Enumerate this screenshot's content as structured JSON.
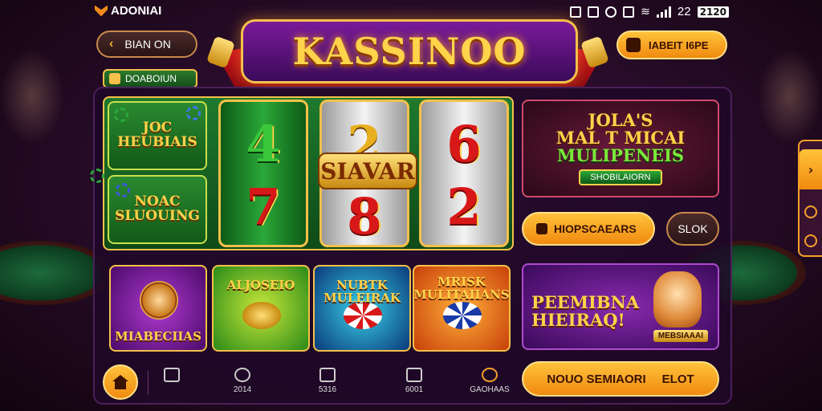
{
  "status": {
    "brand": "ADONIAI",
    "time": "22",
    "battery": "2120"
  },
  "header": {
    "left_button": "BIAN ON",
    "right_button": "IABEIT I6PE",
    "title": "KASSINOO",
    "chip": "DOABOIUN"
  },
  "slots": {
    "side_tiles": [
      "JOC HEUBIAIS",
      "NOAC SLUOUING"
    ],
    "reels": [
      {
        "style": "green",
        "symbols": [
          "4",
          "7"
        ]
      },
      {
        "style": "silver",
        "symbols": [
          "2",
          "8"
        ]
      },
      {
        "style": "silver",
        "symbols": [
          "6",
          "2"
        ]
      }
    ],
    "banner": "SIAVAR"
  },
  "promo_top": {
    "title_line1": "JOLA'S",
    "title_line2": "MAL T MICAI",
    "title_line3": "MULIPENEIS",
    "button": "SHOBILAIORN"
  },
  "buttons": {
    "mid_orange": "HIOPSCAEARS",
    "mid_slot": "SLOK",
    "bottom": "NOUO SEMIAORI",
    "bottom_right": "ELOT"
  },
  "games": [
    {
      "label": "MIABECIIAS"
    },
    {
      "label": "ALJOSEIO"
    },
    {
      "label": "NUBTK MULEIRAK"
    },
    {
      "label": "MRISK MULITAIIANS"
    }
  ],
  "promo_bottom": {
    "line1": "PEEMIBNA",
    "line2": "HIEIRAQ!",
    "tag": "MEBSIAAAI"
  },
  "nav": {
    "items": [
      {
        "label": "2014",
        "icon": "chat-icon"
      },
      {
        "label": "5316",
        "icon": "clock-icon"
      },
      {
        "label": "6001",
        "icon": "document-icon"
      },
      {
        "label": "GAOHAAS",
        "icon": "gear-icon"
      }
    ]
  },
  "colors": {
    "accent_orange": "#f08a10",
    "gold": "#f5c04a",
    "felt_green": "#1e7a2e",
    "background": "#2a0d2c"
  }
}
